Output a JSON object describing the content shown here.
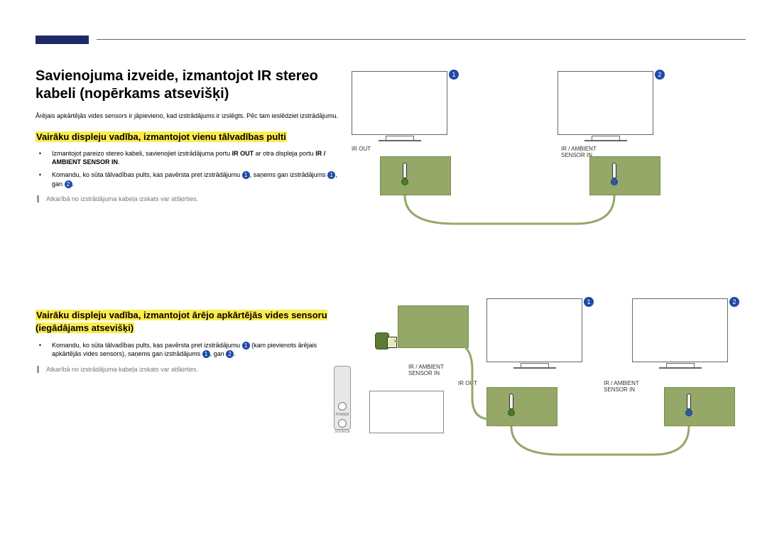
{
  "heading": "Savienojuma izveide, izmantojot IR stereo kabeli (nopērkams atsevišķi)",
  "intro": "Ārējais apkārtējās vides sensors ir jāpievieno, kad izstrādājums ir izslēgts. Pēc tam ieslēdziet izstrādājumu.",
  "section1": {
    "title": "Vairāku displeju vadība, izmantojot vienu tālvadības pulti",
    "bullet1a": "Izmantojot pareizo stereo kabeli, savienojiet izstrādājuma portu ",
    "bullet1b": "IR OUT",
    "bullet1c": " ar otra displeja portu ",
    "bullet1d": "IR / AMBIENT SENSOR IN",
    "bullet1e": ".",
    "bullet2a": "Komandu, ko sūta tālvadības pults, kas pavērsta pret izstrādājumu ",
    "bullet2b": ", saņems gan izstrādājums ",
    "bullet2c": ", gan ",
    "bullet2d": ".",
    "note": "Atkarībā no izstrādājuma kabeļa izskats var atšķirties."
  },
  "section2": {
    "title": "Vairāku displeju vadība, izmantojot ārējo apkārtējās vides sensoru (iegādājams atsevišķi)",
    "bullet1a": "Komandu, ko sūta tālvadības pults, kas pavērsta pret izstrādājumu ",
    "bullet1b": " (kam pievienots ārējais apkārtējās vides sensors), saņems gan izstrādājums ",
    "bullet1c": ", gan ",
    "bullet1d": ".",
    "note": "Atkarībā no izstrādājuma kabeļa izskats var atšķirties."
  },
  "labels": {
    "irout": "IR OUT",
    "irin": "IR / AMBIENT\nSENSOR IN",
    "power": "POWER",
    "source": "SOURCE"
  },
  "nums": {
    "one": "1",
    "two": "2"
  }
}
